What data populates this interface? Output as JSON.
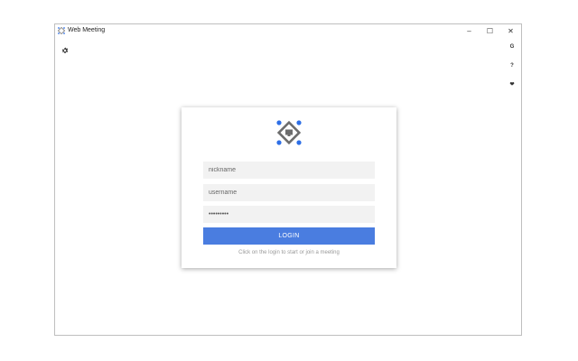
{
  "window": {
    "title": "Web Meeting",
    "controls": {
      "minimize": "–",
      "maximize": "☐",
      "close": "✕"
    }
  },
  "toolbar": {
    "settings_icon": "gear-icon",
    "side_tools": [
      {
        "name": "g-tool",
        "label": "G"
      },
      {
        "name": "help-tool",
        "label": "?"
      },
      {
        "name": "heart-tool",
        "label": "❤"
      }
    ]
  },
  "login": {
    "nickname_placeholder": "nickname",
    "username_placeholder": "username",
    "password_value": "password1",
    "login_label": "LOGIN",
    "hint": "Click on the login to start or join a meeting"
  },
  "colors": {
    "accent": "#4a7de0",
    "logo_dot": "#2e6fe6",
    "logo_frame": "#6d6d6d"
  }
}
